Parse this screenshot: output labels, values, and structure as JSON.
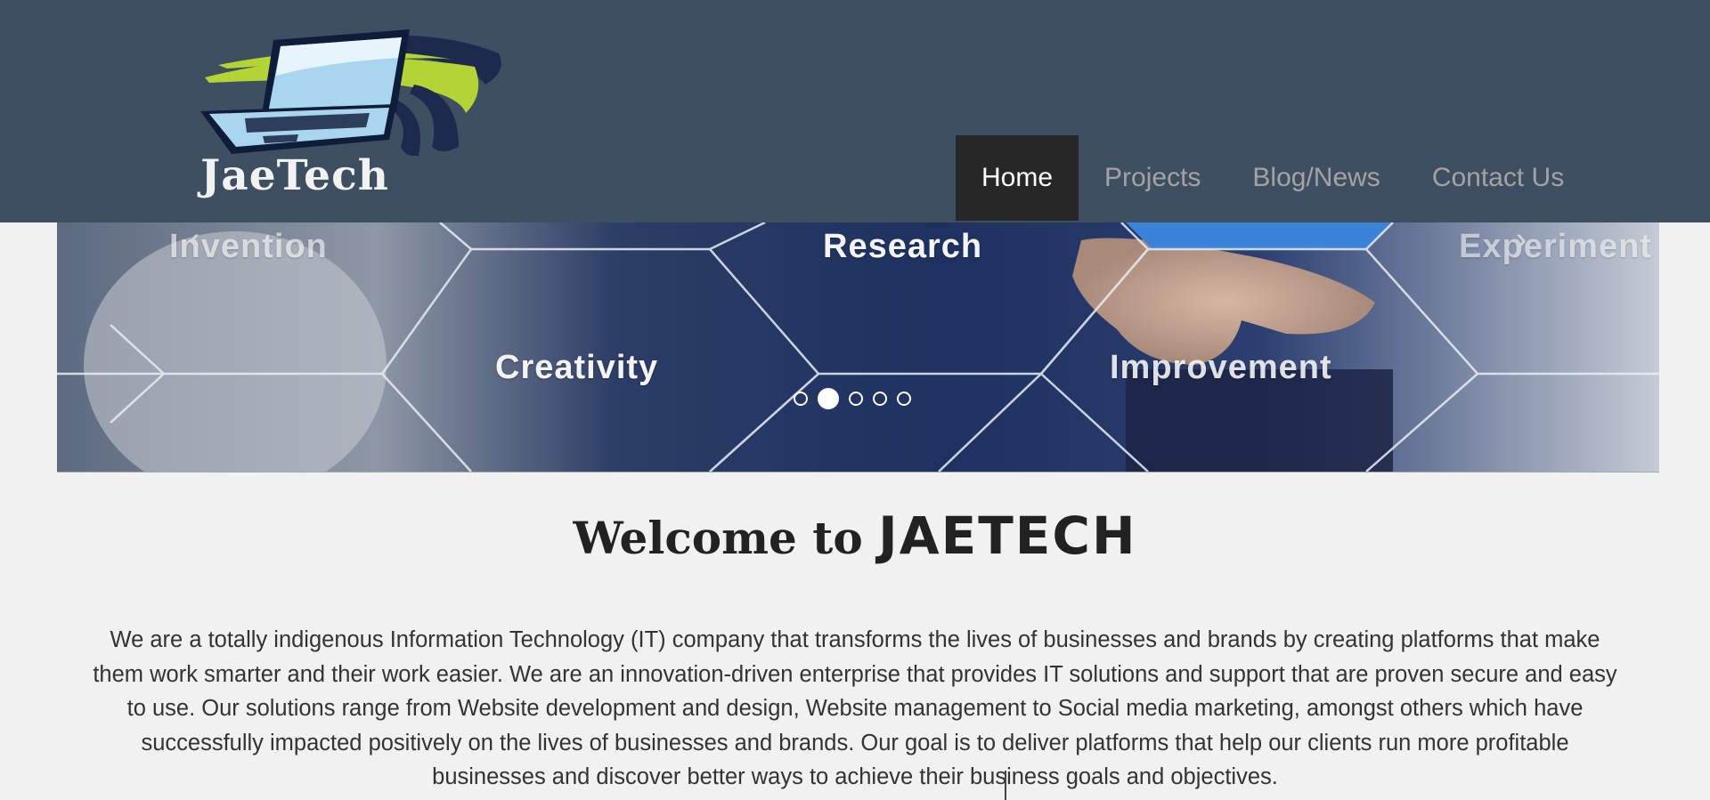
{
  "header": {
    "logo_text": "JaeTech",
    "nav": [
      {
        "label": "Home",
        "active": true
      },
      {
        "label": "Projects",
        "active": false
      },
      {
        "label": "Blog/News",
        "active": false
      },
      {
        "label": "Contact Us",
        "active": false
      }
    ]
  },
  "banner": {
    "labels": {
      "invention": "Invention",
      "research": "Research",
      "experiment": "Experiment",
      "creativity": "Creativity",
      "improvement": "Improvement"
    },
    "prev_icon": "chevron-left-icon",
    "next_icon": "chevron-right-icon",
    "slides_count": 5,
    "active_slide": 2
  },
  "content": {
    "welcome_prefix": "Welcome to",
    "welcome_brand": "JAETECH",
    "intro": "We are a totally indigenous Information Technology (IT) company that transforms the lives of businesses and brands by creating platforms that make them work smarter and their work easier. We are an innovation-driven enterprise that provides IT solutions and support that are proven secure and easy to use. Our solutions range from Website development and design, Website management to Social media marketing, amongst others which have successfully impacted positively on the lives of businesses and brands. Our goal is to deliver platforms that help our clients run more profitable businesses and discover better ways to achieve their business goals and objectives."
  },
  "colors": {
    "header_bg": "#3e4f62",
    "nav_active_bg": "#272727",
    "nav_text": "#a3a3a3",
    "page_bg": "#f1f1f1",
    "logo_green": "#b4d335",
    "logo_navy": "#1d2a4d",
    "logo_screen": "#a9d6ee"
  }
}
